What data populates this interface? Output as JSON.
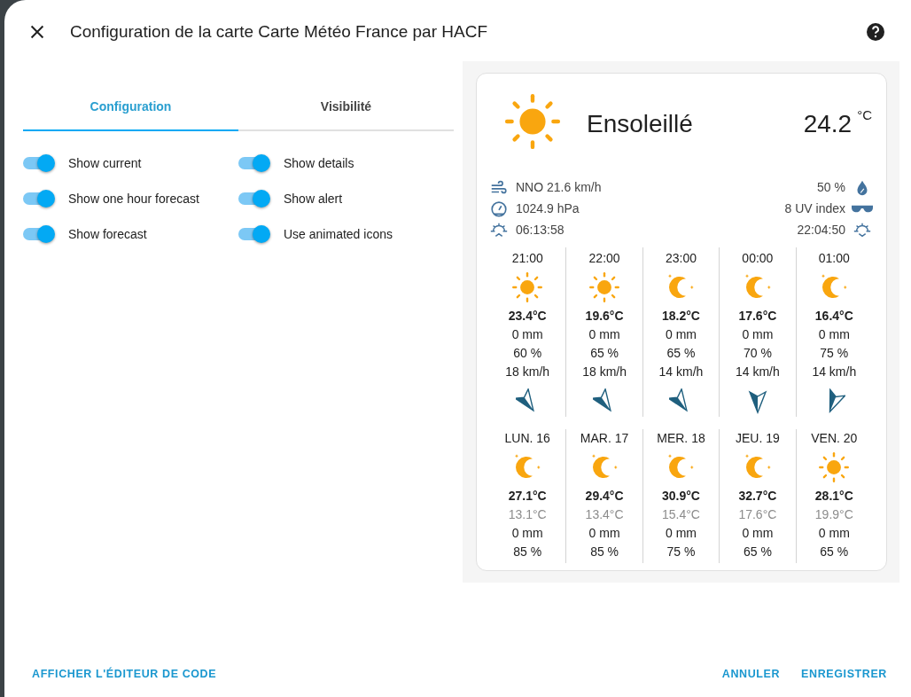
{
  "dialog": {
    "title": "Configuration de la carte Carte Météo France par HACF"
  },
  "tabs": [
    {
      "label": "Configuration",
      "selected": true
    },
    {
      "label": "Visibilité",
      "selected": false
    }
  ],
  "toggles": [
    {
      "label": "Show current",
      "on": true
    },
    {
      "label": "Show details",
      "on": true
    },
    {
      "label": "Show one hour forecast",
      "on": true
    },
    {
      "label": "Show alert",
      "on": true
    },
    {
      "label": "Show forecast",
      "on": true
    },
    {
      "label": "Use animated icons",
      "on": true
    }
  ],
  "preview": {
    "current": {
      "kind": "sun",
      "condition": "Ensoleillé",
      "temperature": "24.2",
      "unit": "°C"
    },
    "details_left": [
      {
        "kind": "wind",
        "text": "NNO 21.6 km/h"
      },
      {
        "kind": "pressure",
        "text": "1024.9 hPa"
      },
      {
        "kind": "sunrise",
        "text": "06:13:58"
      }
    ],
    "details_right": [
      {
        "kind": "humidity",
        "text": "50 %"
      },
      {
        "kind": "uv",
        "text": "8 UV index"
      },
      {
        "kind": "sunset",
        "text": "22:04:50"
      }
    ],
    "hourly": [
      {
        "time": "21:00",
        "kind": "sun",
        "temperature": "23.4°C",
        "precipitation": "0 mm",
        "humidity": "60 %",
        "wind": "18 km/h",
        "wind_arrow": {
          "kind": "nno"
        }
      },
      {
        "time": "22:00",
        "kind": "sun",
        "temperature": "19.6°C",
        "precipitation": "0 mm",
        "humidity": "65 %",
        "wind": "18 km/h",
        "wind_arrow": {
          "kind": "nno"
        }
      },
      {
        "time": "23:00",
        "kind": "night",
        "temperature": "18.2°C",
        "precipitation": "0 mm",
        "humidity": "65 %",
        "wind": "14 km/h",
        "wind_arrow": {
          "kind": "nno"
        }
      },
      {
        "time": "00:00",
        "kind": "night",
        "temperature": "17.6°C",
        "precipitation": "0 mm",
        "humidity": "70 %",
        "wind": "14 km/h",
        "wind_arrow": {
          "kind": "n"
        }
      },
      {
        "time": "01:00",
        "kind": "night",
        "temperature": "16.4°C",
        "precipitation": "0 mm",
        "humidity": "75 %",
        "wind": "14 km/h",
        "wind_arrow": {
          "kind": "nne"
        }
      }
    ],
    "daily": [
      {
        "day": "LUN. 16",
        "kind": "night",
        "high": "27.1°C",
        "low": "13.1°C",
        "precipitation": "0 mm",
        "humidity": "85 %"
      },
      {
        "day": "MAR. 17",
        "kind": "night",
        "high": "29.4°C",
        "low": "13.4°C",
        "precipitation": "0 mm",
        "humidity": "85 %"
      },
      {
        "day": "MER. 18",
        "kind": "night",
        "high": "30.9°C",
        "low": "15.4°C",
        "precipitation": "0 mm",
        "humidity": "75 %"
      },
      {
        "day": "JEU. 19",
        "kind": "night",
        "high": "32.7°C",
        "low": "17.6°C",
        "precipitation": "0 mm",
        "humidity": "65 %"
      },
      {
        "day": "VEN. 20",
        "kind": "sun",
        "high": "28.1°C",
        "low": "19.9°C",
        "precipitation": "0 mm",
        "humidity": "65 %"
      }
    ]
  },
  "footer": {
    "left_buttons": [
      "AFFICHER L'ÉDITEUR DE CODE"
    ],
    "right_buttons": [
      "ANNULER",
      "ENREGISTRER"
    ]
  }
}
